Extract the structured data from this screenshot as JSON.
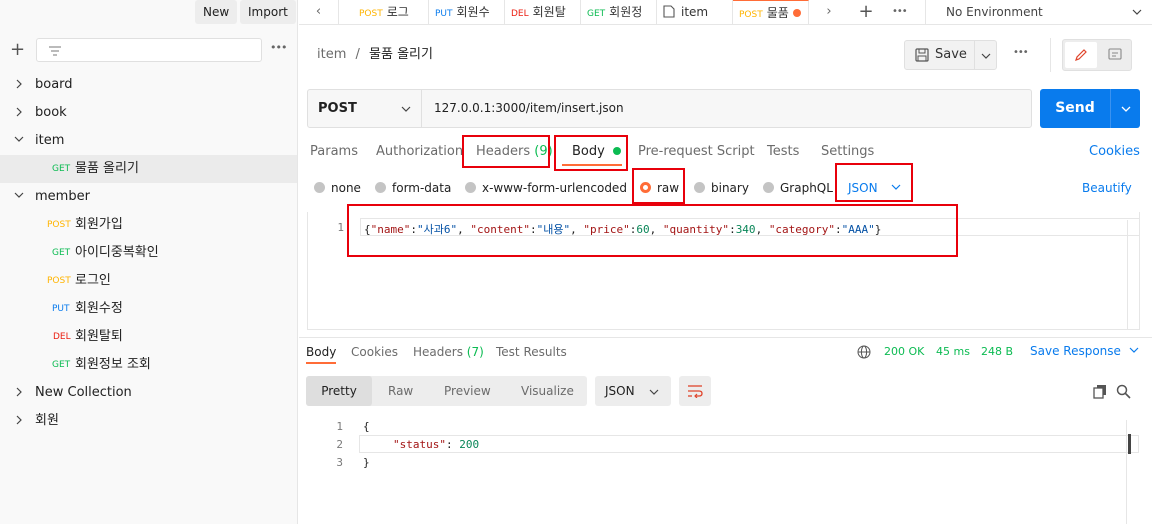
{
  "sidebar": {
    "new_label": "New",
    "import_label": "Import",
    "more": "•••",
    "tree": [
      {
        "type": "folder",
        "label": "board",
        "open": false,
        "level": 0
      },
      {
        "type": "folder",
        "label": "book",
        "open": false,
        "level": 0
      },
      {
        "type": "folder",
        "label": "item",
        "open": true,
        "level": 0
      },
      {
        "type": "request",
        "method": "GET",
        "label": "물품 올리기",
        "level": 1,
        "selected": true
      },
      {
        "type": "folder",
        "label": "member",
        "open": true,
        "level": 0
      },
      {
        "type": "request",
        "method": "POST",
        "label": "회원가입",
        "level": 1
      },
      {
        "type": "request",
        "method": "GET",
        "label": "아이디중복확인",
        "level": 1
      },
      {
        "type": "request",
        "method": "POST",
        "label": "로그인",
        "level": 1
      },
      {
        "type": "request",
        "method": "PUT",
        "label": "회원수정",
        "level": 1
      },
      {
        "type": "request",
        "method": "DEL",
        "label": "회원탈퇴",
        "level": 1
      },
      {
        "type": "request",
        "method": "GET",
        "label": "회원정보 조회",
        "level": 1
      },
      {
        "type": "folder",
        "label": "New Collection",
        "open": false,
        "level": 0
      },
      {
        "type": "folder",
        "label": "회원",
        "open": false,
        "level": 0
      }
    ]
  },
  "tabs": [
    {
      "method": "POST",
      "label": "로그"
    },
    {
      "method": "PUT",
      "label": "회원수"
    },
    {
      "method": "DEL",
      "label": "회원탈"
    },
    {
      "method": "GET",
      "label": "회원정"
    },
    {
      "method": "",
      "label": "item"
    },
    {
      "method": "POST",
      "label": "물품"
    }
  ],
  "tab_more": "•••",
  "environment": "No Environment",
  "breadcrumb": {
    "parent": "item",
    "sep": "/",
    "current": "물품 올리기"
  },
  "save_label": "Save",
  "request": {
    "method": "POST",
    "url": "127.0.0.1:3000/item/insert.json",
    "send_label": "Send"
  },
  "subtabs": {
    "params": "Params",
    "authorization": "Authorization",
    "headers": "Headers",
    "headers_count": "(9)",
    "body": "Body",
    "prerequest": "Pre-request Script",
    "tests": "Tests",
    "settings": "Settings",
    "cookies": "Cookies"
  },
  "body_options": {
    "none": "none",
    "form_data": "form-data",
    "urlencoded": "x-www-form-urlencoded",
    "raw": "raw",
    "binary": "binary",
    "graphql": "GraphQL",
    "format": "JSON",
    "beautify": "Beautify"
  },
  "request_body": {
    "line": "1",
    "brace_open": "{",
    "brace_close": "}",
    "pairs": [
      {
        "k": "\"name\"",
        "v": "\"사과6\""
      },
      {
        "k": "\"content\"",
        "v": "\"내용\""
      },
      {
        "k": "\"price\"",
        "v": "60"
      },
      {
        "k": "\"quantity\"",
        "v": "340"
      },
      {
        "k": "\"category\"",
        "v": "\"AAA\""
      }
    ]
  },
  "response": {
    "tabs": {
      "body": "Body",
      "cookies": "Cookies",
      "headers": "Headers",
      "headers_count": "(7)",
      "tests": "Test Results"
    },
    "status": "200 OK",
    "time": "45 ms",
    "size": "248 B",
    "save_response": "Save Response",
    "views": {
      "pretty": "Pretty",
      "raw": "Raw",
      "preview": "Preview",
      "visualize": "Visualize"
    },
    "format": "JSON",
    "lines": [
      "1",
      "2",
      "3"
    ],
    "brace_open": "{",
    "brace_close": "}",
    "key": "\"status\"",
    "colon": ":",
    "value": "200"
  },
  "colors": {
    "accent": "#ff6c37",
    "send": "#097bed",
    "highlight": "#e8000b",
    "ok": "#0cbb52"
  }
}
